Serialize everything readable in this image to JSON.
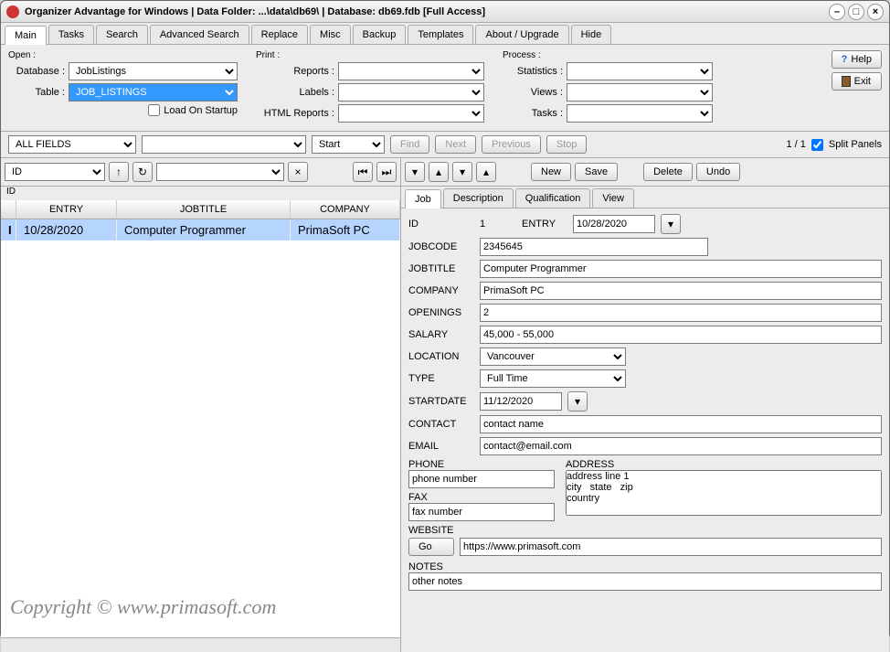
{
  "window": {
    "title": "Organizer Advantage for Windows | Data Folder: ...\\data\\db69\\ | Database: db69.fdb [Full Access]"
  },
  "main_tabs": [
    "Main",
    "Tasks",
    "Search",
    "Advanced Search",
    "Replace",
    "Misc",
    "Backup",
    "Templates",
    "About / Upgrade",
    "Hide"
  ],
  "main_tabs_active": 0,
  "open_group": {
    "title": "Open :",
    "database_label": "Database :",
    "database_value": "JobListings",
    "table_label": "Table :",
    "table_value": "JOB_LISTINGS",
    "load_startup_label": "Load On Startup",
    "load_startup_checked": false
  },
  "print_group": {
    "title": "Print :",
    "reports_label": "Reports :",
    "labels_label": "Labels :",
    "html_label": "HTML Reports :"
  },
  "process_group": {
    "title": "Process :",
    "stats_label": "Statistics :",
    "views_label": "Views :",
    "tasks_label": "Tasks :"
  },
  "help_btn": "Help",
  "exit_btn": "Exit",
  "filter_bar": {
    "fields_value": "ALL FIELDS",
    "mode_value": "Start",
    "find_btn": "Find",
    "next_btn": "Next",
    "prev_btn": "Previous",
    "stop_btn": "Stop",
    "page_info": "1 / 1",
    "split_label": "Split Panels",
    "split_checked": true
  },
  "left_toolbar": {
    "sort_value": "ID",
    "sort_sub": "ID"
  },
  "grid": {
    "columns": [
      "ENTRY",
      "JOBTITLE",
      "COMPANY"
    ],
    "rows": [
      {
        "entry": "10/28/2020",
        "jobtitle": "Computer Programmer",
        "company": "PrimaSoft PC"
      }
    ]
  },
  "watermark": "Copyright ©   www.primasoft.com",
  "right_toolbar": {
    "new_btn": "New",
    "save_btn": "Save",
    "delete_btn": "Delete",
    "undo_btn": "Undo"
  },
  "detail_tabs": [
    "Job",
    "Description",
    "Qualification",
    "View"
  ],
  "detail_tabs_active": 0,
  "detail": {
    "id_label": "ID",
    "id_value": "1",
    "entry_label": "ENTRY",
    "entry_value": "10/28/2020",
    "jobcode_label": "JOBCODE",
    "jobcode_value": "2345645",
    "jobtitle_label": "JOBTITLE",
    "jobtitle_value": "Computer Programmer",
    "company_label": "COMPANY",
    "company_value": "PrimaSoft PC",
    "openings_label": "OPENINGS",
    "openings_value": "2",
    "salary_label": "SALARY",
    "salary_value": "45,000 - 55,000",
    "location_label": "LOCATION",
    "location_value": "Vancouver",
    "type_label": "TYPE",
    "type_value": "Full Time",
    "startdate_label": "STARTDATE",
    "startdate_value": "11/12/2020",
    "contact_label": "CONTACT",
    "contact_value": "contact name",
    "email_label": "EMAIL",
    "email_value": "contact@email.com",
    "phone_label": "PHONE",
    "phone_value": "phone number",
    "fax_label": "FAX",
    "fax_value": "fax number",
    "address_label": "ADDRESS",
    "address_value": "address line 1\ncity   state   zip\ncountry",
    "website_label": "WEBSITE",
    "website_go": "Go",
    "website_value": "https://www.primasoft.com",
    "notes_label": "NOTES",
    "notes_value": "other notes"
  }
}
